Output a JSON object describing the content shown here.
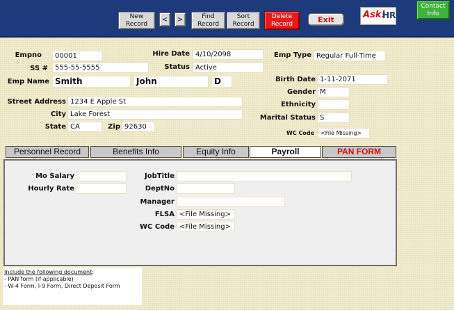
{
  "toolbar": {
    "new_record": "New\nRecord",
    "prev": "<",
    "next": ">",
    "find_record": "Find\nRecord",
    "sort_record": "Sort\nRecord",
    "delete_record": "Delete\nRecord",
    "exit": "Exit",
    "contact_info": "Contact\nInfo",
    "logo_ask": "Ask!",
    "logo_hr": "HR"
  },
  "employee": {
    "empno_label": "Empno",
    "empno": "00001",
    "hire_date_label": "Hire Date",
    "hire_date": "4/10/2098",
    "emp_type_label": "Emp Type",
    "emp_type": "Regular Full-Time",
    "ssn_label": "SS #",
    "ssn": "555-55-5555",
    "status_label": "Status",
    "status": "Active",
    "emp_name_label": "Emp Name",
    "last_name": "Smith",
    "first_name": "John",
    "middle_initial": "D",
    "birth_date_label": "Birth Date",
    "birth_date": "1-11-2071",
    "gender_label": "Gender",
    "gender": "M",
    "ethnicity_label": "Ethnicity",
    "ethnicity": "",
    "marital_status_label": "Marital Status",
    "marital_status": "S",
    "street_label": "Street Address",
    "street": "1234 E Apple St",
    "city_label": "City",
    "city": "Lake Forest",
    "state_label": "State",
    "state": "CA",
    "zip_label": "Zip",
    "zip": "92630",
    "wc_code_label": "WC Code",
    "wc_code": "<File Missing>"
  },
  "tabs": [
    {
      "label": "Personnel Record"
    },
    {
      "label": "Benefits Info"
    },
    {
      "label": "Equity Info"
    },
    {
      "label": "Payroll"
    },
    {
      "label": "PAN FORM"
    }
  ],
  "payroll": {
    "mo_salary_label": "Mo Salary",
    "mo_salary": "",
    "hourly_rate_label": "Hourly Rate",
    "hourly_rate": "",
    "jobtitle_label": "JobTitle",
    "jobtitle": "",
    "deptno_label": "DeptNo",
    "deptno": "",
    "manager_label": "Manager",
    "manager": "",
    "flsa_label": "FLSA",
    "flsa": "<File Missing>",
    "wc_code_label": "WC Code",
    "wc_code": "<File Missing>"
  },
  "documents": {
    "header": "Include the following document",
    "header_suffix": ":",
    "line1": "- PAN form (if applicable)",
    "line2": "- W-4 Form, I-9 Form, Direct Deposit Form"
  },
  "colors": {
    "topbar": "#1d3a7a",
    "background": "#f2edce",
    "delete": "#e81a1a",
    "contact": "#3fb23a",
    "accent_red": "#d41010"
  }
}
